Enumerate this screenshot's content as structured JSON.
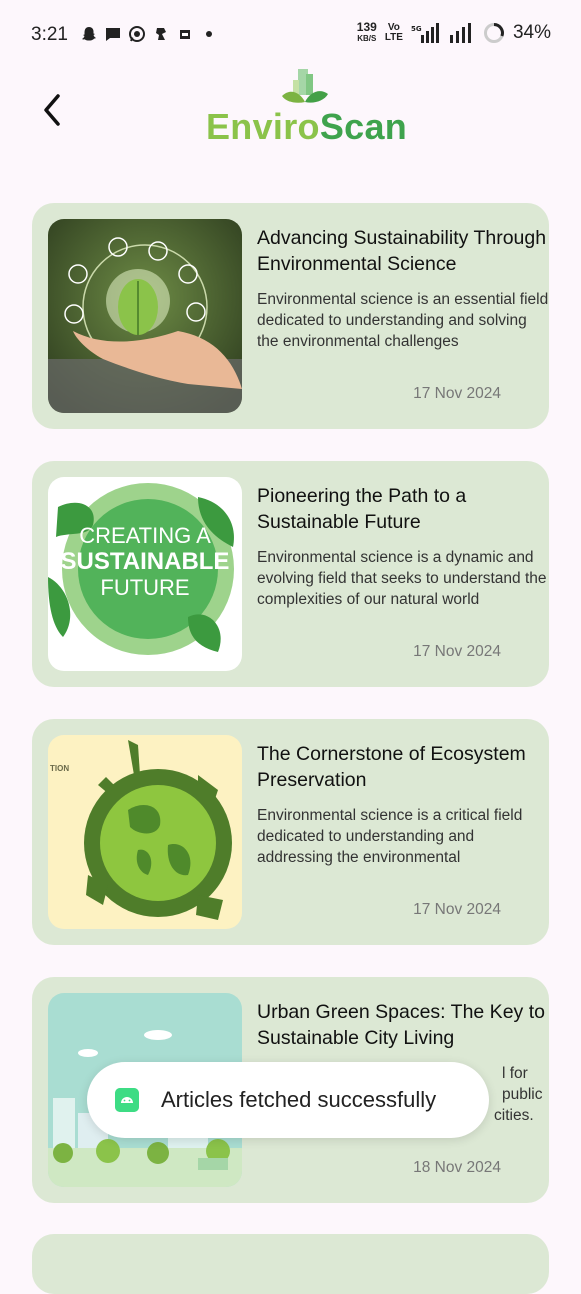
{
  "status_bar": {
    "time": "3:21",
    "net_speed_value": "139",
    "net_speed_unit": "KB/S",
    "volte_top": "Vo",
    "volte_bottom": "LTE",
    "battery": "34%"
  },
  "header": {
    "back_icon": "arrow-back-icon",
    "logo_part1": "Enviro",
    "logo_part2": "Scan"
  },
  "articles": [
    {
      "title": "Advancing Sustainability Through Environmental Science",
      "description": "Environmental science is an essential field dedicated to understanding and solving the environmental challenges",
      "date": "17 Nov 2024"
    },
    {
      "title": "Pioneering the Path to a Sustainable Future",
      "description": "Environmental science is a dynamic and evolving field that seeks to understand the complexities of our natural world",
      "date": "17 Nov 2024",
      "image_text": [
        "CREATING A",
        "SUSTAINABLE",
        "FUTURE"
      ]
    },
    {
      "title": "The Cornerstone of Ecosystem Preservation",
      "description": "Environmental science is a critical field dedicated to understanding and addressing the environmental",
      "date": "17 Nov 2024",
      "image_text": [
        "TION"
      ]
    },
    {
      "title": "Urban Green Spaces: The Key to Sustainable City Living",
      "description_visible": [
        "l for",
        "public",
        "cities."
      ],
      "date": "18 Nov 2024"
    }
  ],
  "toast": {
    "message": "Articles fetched successfully"
  },
  "colors": {
    "background": "#fdf7fc",
    "card": "#dce8d4",
    "logo_light": "#8bc34a",
    "logo_dark": "#3fa34d"
  }
}
